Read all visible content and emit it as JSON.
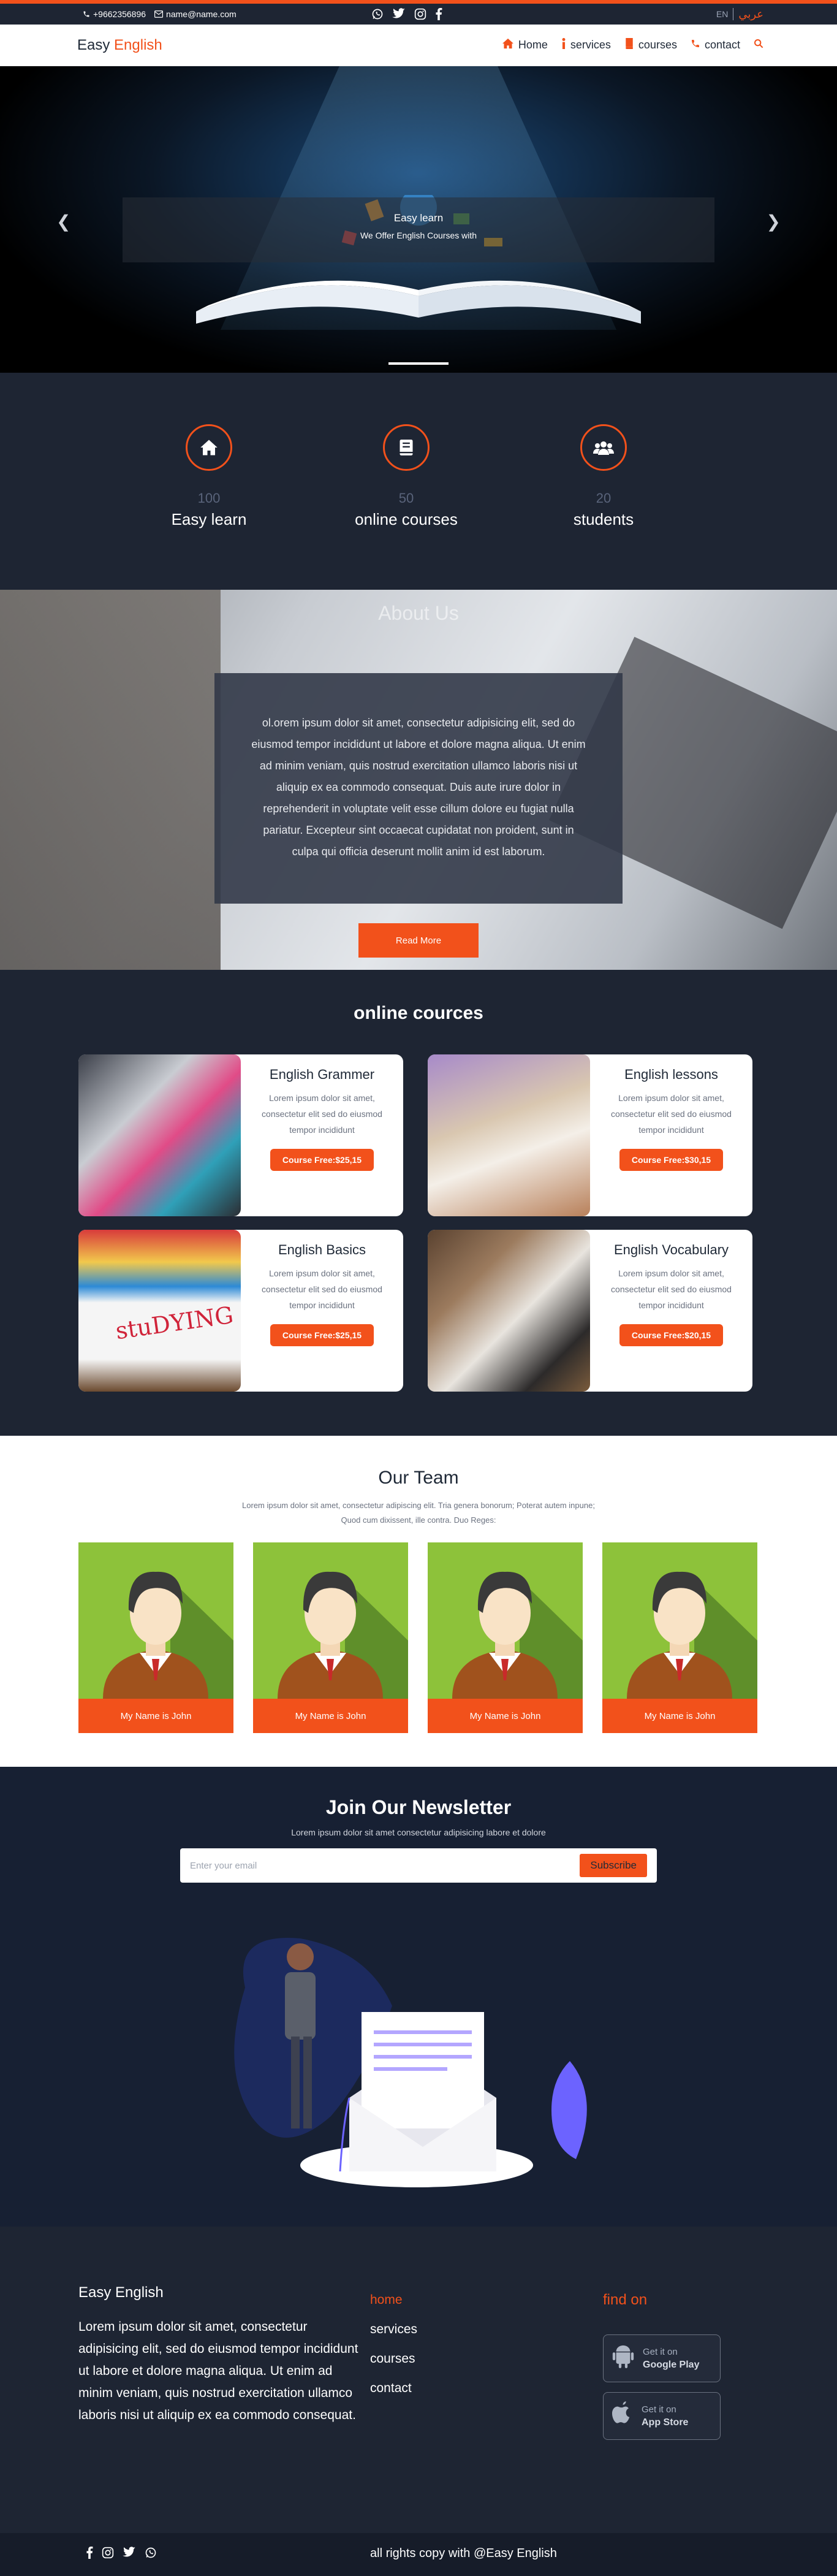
{
  "topbar": {
    "phone": "+9662356896",
    "email": "name@name.com",
    "lang_en": "EN",
    "lang_ar": "عربي",
    "social_icons": [
      "whatsapp-icon",
      "twitter-icon",
      "instagram-icon",
      "facebook-icon"
    ]
  },
  "nav": {
    "brand_main": "Easy ",
    "brand_accent": "English",
    "items": [
      {
        "label": "Home",
        "icon": "home-icon"
      },
      {
        "label": "services",
        "icon": "info-icon"
      },
      {
        "label": "courses",
        "icon": "book-icon"
      },
      {
        "label": "contact",
        "icon": "phone-icon"
      }
    ],
    "search_icon": "search-icon"
  },
  "hero": {
    "title": "Easy learn",
    "subtitle": "We Offer English Courses with"
  },
  "stats": [
    {
      "num": "100",
      "label": "Easy learn",
      "icon": "home-icon"
    },
    {
      "num": "50",
      "label": "online courses",
      "icon": "book-icon"
    },
    {
      "num": "20",
      "label": "students",
      "icon": "users-icon"
    }
  ],
  "about": {
    "title": "About Us",
    "text": "ol.orem ipsum dolor sit amet, consectetur adipisicing elit, sed do eiusmod tempor incididunt ut labore et dolore magna aliqua. Ut enim ad minim veniam, quis nostrud exercitation ullamco laboris nisi ut aliquip ex ea commodo consequat. Duis aute irure dolor in reprehenderit in voluptate velit esse cillum dolore eu fugiat nulla pariatur. Excepteur sint occaecat cupidatat non proident, sunt in culpa qui officia deserunt mollit anim id est laborum.",
    "button": "Read More"
  },
  "courses": {
    "title": "online cources",
    "items": [
      {
        "title": "English Grammer",
        "desc": "Lorem ipsum dolor sit amet, consectetur elit sed do eiusmod tempor incididunt",
        "price": "Course Free:$25,15"
      },
      {
        "title": "English lessons",
        "desc": "Lorem ipsum dolor sit amet, consectetur elit sed do eiusmod tempor incididunt",
        "price": "Course Free:$30,15"
      },
      {
        "title": "English Basics",
        "desc": "Lorem ipsum dolor sit amet, consectetur elit sed do eiusmod tempor incididunt",
        "price": "Course Free:$25,15"
      },
      {
        "title": "English Vocabulary",
        "desc": "Lorem ipsum dolor sit amet, consectetur elit sed do eiusmod tempor incididunt",
        "price": "Course Free:$20,15"
      }
    ]
  },
  "team": {
    "title": "Our Team",
    "subtitle": "Lorem ipsum dolor sit amet, consectetur adipiscing elit. Tria genera bonorum; Poterat autem inpune; Quod cum dixissent, ille contra. Duo Reges:",
    "members": [
      {
        "name": "My Name is John"
      },
      {
        "name": "My Name is John"
      },
      {
        "name": "My Name is John"
      },
      {
        "name": "My Name is John"
      }
    ]
  },
  "newsletter": {
    "title": "Join Our Newsletter",
    "subtitle": "Lorem ipsum dolor sit amet consectetur adipisicing labore et dolore",
    "placeholder": "Enter your email",
    "button": "Subscribe"
  },
  "footer": {
    "brand": "Easy English",
    "text": "Lorem ipsum dolor sit amet, consectetur adipisicing elit, sed do eiusmod tempor incididunt ut labore et dolore magna aliqua. Ut enim ad minim veniam, quis nostrud exercitation ullamco laboris nisi ut aliquip ex ea commodo consequat.",
    "links": [
      "home",
      "services",
      "courses",
      "contact"
    ],
    "find_on": "find on",
    "store1_line1": "Get it on",
    "store1_line2": "Google Play",
    "store2_line1": "Get it on",
    "store2_line2": "App Store",
    "copyright": "all rights copy with @Easy English",
    "social_icons": [
      "facebook-icon",
      "instagram-icon",
      "twitter-icon",
      "whatsapp-icon"
    ]
  },
  "colors": {
    "accent": "#f2511b",
    "dark": "#1e2533",
    "navy": "#172033"
  }
}
